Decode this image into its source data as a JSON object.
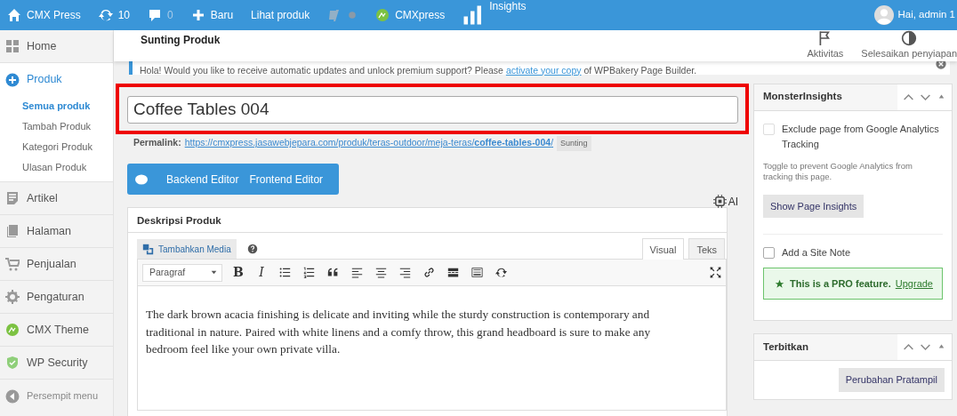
{
  "topbar": {
    "items": [
      {
        "kind": "home",
        "label": "CMX Press"
      },
      {
        "kind": "updates",
        "label": "10"
      },
      {
        "kind": "comments",
        "label": "0"
      },
      {
        "kind": "new",
        "label": "Baru"
      },
      {
        "kind": "link",
        "label": "Lihat produk"
      },
      {
        "kind": "yoast"
      },
      {
        "kind": "cmx",
        "label": "CMXpress"
      },
      {
        "kind": "insights",
        "label": "Insights"
      }
    ],
    "user": "Hai, admin 1"
  },
  "sidebar": {
    "items": [
      {
        "kind": "dashboard",
        "label": "Home",
        "selected": false
      },
      {
        "kind": "plus",
        "label": "Produk",
        "selected": true,
        "children": [
          {
            "label": "Semua produk",
            "selected": true
          },
          {
            "label": "Tambah Produk",
            "selected": false
          },
          {
            "label": "Kategori Produk",
            "selected": false
          },
          {
            "label": "Ulasan Produk",
            "selected": false
          }
        ]
      },
      {
        "kind": "post",
        "label": "Artikel",
        "selected": false
      },
      {
        "kind": "page",
        "label": "Halaman",
        "selected": false
      },
      {
        "kind": "cart",
        "label": "Penjualan",
        "selected": false
      },
      {
        "kind": "gear",
        "label": "Pengaturan",
        "selected": false
      },
      {
        "kind": "cmx",
        "label": "CMX Theme",
        "selected": false
      },
      {
        "kind": "shield",
        "label": "WP Security",
        "selected": false
      }
    ],
    "collapse_label": "Persempit menu"
  },
  "header": {
    "title": "Sunting Produk",
    "actions": [
      {
        "kind": "flag",
        "label": "Aktivitas"
      },
      {
        "kind": "contrast",
        "label": "Selesaikan penyiapan"
      }
    ]
  },
  "notice": {
    "text_before": "Hola! Would you like to receive automatic updates and unlock premium support? Please ",
    "link": "activate your copy",
    "text_after": " of WPBakery Page Builder."
  },
  "title_field": {
    "value": "Coffee Tables 004",
    "highlighted": true
  },
  "permalink": {
    "label": "Permalink:",
    "url": "https://cmxpress.jasawebjepara.com/produk/teras-outdoor/meja-teras/**coffee-tables-004**/",
    "edit_button": "Sunting"
  },
  "builder": {
    "buttons": [
      "Backend Editor",
      "Frontend Editor"
    ]
  },
  "ai_label": "AI",
  "description": {
    "title": "Deskripsi Produk",
    "media_button": "Tambahkan Media",
    "tabs": [
      {
        "label": "Visual",
        "selected": true
      },
      {
        "label": "Teks",
        "selected": false
      }
    ],
    "format_select": "Paragraf",
    "toolbar": [
      {
        "kind": "bold",
        "label": "B"
      },
      {
        "kind": "italic",
        "label": "I"
      },
      {
        "kind": "bullets"
      },
      {
        "kind": "numbers"
      },
      {
        "kind": "quote"
      },
      {
        "kind": "align-left"
      },
      {
        "kind": "align-center"
      },
      {
        "kind": "align-right"
      },
      {
        "kind": "link"
      },
      {
        "kind": "more"
      },
      {
        "kind": "keyboard"
      },
      {
        "kind": "refresh"
      }
    ],
    "content": "The dark brown acacia finishing is delicate and inviting while the sturdy construction is contemporary and traditional in nature. Paired with white linens and a comfy throw, this grand headboard is sure to make any bedroom feel like your own private villa."
  },
  "monsterinsights": {
    "title": "MonsterInsights",
    "exclude": {
      "label": "Exclude page from Google Analytics Tracking",
      "checked": false
    },
    "hint": "Toggle to prevent Google Analytics from tracking this page.",
    "insights_button": "Show Page Insights",
    "site_note": {
      "label": "Add a Site Note",
      "checked": false
    },
    "pro": {
      "text": "This is a PRO feature.",
      "link": "Upgrade"
    }
  },
  "publish": {
    "title": "Terbitkan",
    "preview_button": "Perubahan Pratampil"
  }
}
